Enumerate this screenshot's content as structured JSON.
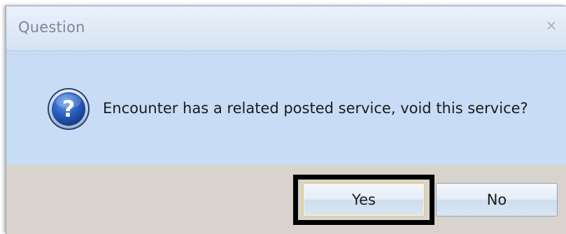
{
  "dialog": {
    "title": "Question",
    "close_glyph": "×",
    "icon": "question-icon",
    "message": "Encounter has a related posted service, void this service?",
    "buttons": {
      "yes_label": "Yes",
      "no_label": "No"
    },
    "highlighted_button": "Yes"
  },
  "colors": {
    "titlebar": "#dfe9f6",
    "content": "#c8dcf6",
    "footer": "#d8d3cc",
    "highlight_border": "#000000",
    "icon_blue": "#1f4fa8"
  }
}
